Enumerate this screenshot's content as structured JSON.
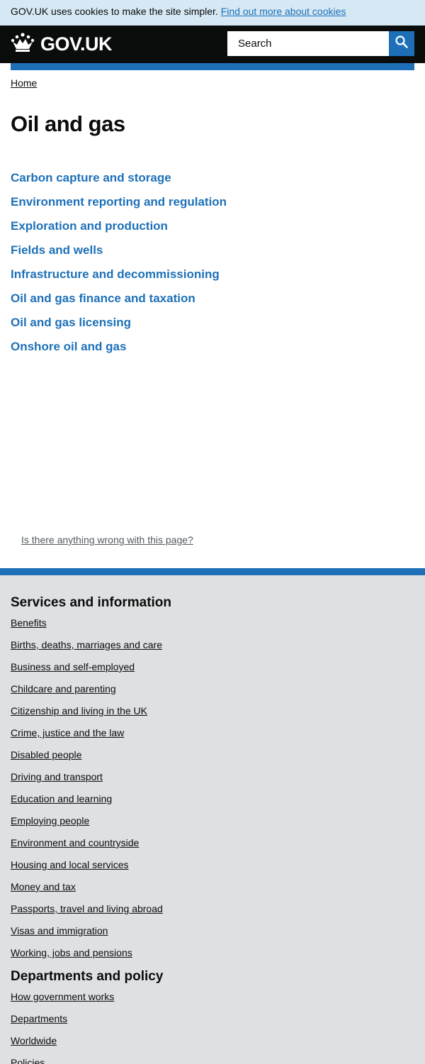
{
  "cookie_banner": {
    "text": "GOV.UK uses cookies to make the site simpler.",
    "link": "Find out more about cookies"
  },
  "header": {
    "logo_text": "GOV.UK",
    "search_placeholder": "Search"
  },
  "breadcrumb": {
    "home": "Home"
  },
  "page": {
    "title": "Oil and gas",
    "topics": [
      "Carbon capture and storage",
      "Environment reporting and regulation",
      "Exploration and production",
      "Fields and wells",
      "Infrastructure and decommissioning",
      "Oil and gas finance and taxation",
      "Oil and gas licensing",
      "Onshore oil and gas"
    ],
    "report_link": "Is there anything wrong with this page?"
  },
  "footer": {
    "services_heading": "Services and information",
    "services": [
      "Benefits",
      "Births, deaths, marriages and care",
      "Business and self-employed",
      "Childcare and parenting",
      "Citizenship and living in the UK",
      "Crime, justice and the law",
      "Disabled people",
      "Driving and transport",
      "Education and learning",
      "Employing people",
      "Environment and countryside",
      "Housing and local services",
      "Money and tax",
      "Passports, travel and living abroad",
      "Visas and immigration",
      "Working, jobs and pensions"
    ],
    "departments_heading": "Departments and policy",
    "departments": [
      "How government works",
      "Departments",
      "Worldwide",
      "Policies"
    ]
  },
  "colors": {
    "link_blue": "#1d70b8",
    "header_black": "#0b0c0c",
    "cookie_bg": "#d5e8f3",
    "footer_bg": "#dee0e2"
  },
  "icons": [
    "crown-icon",
    "search-icon"
  ]
}
